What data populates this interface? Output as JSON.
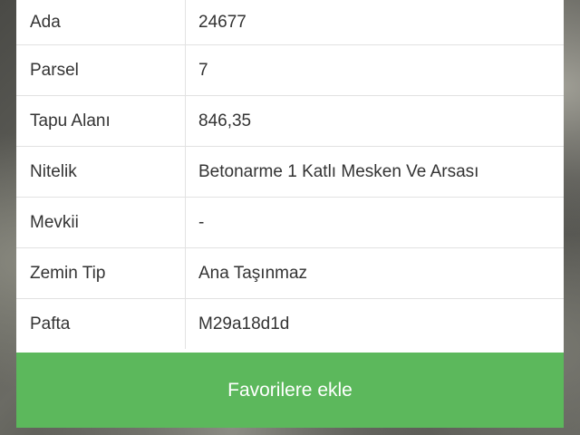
{
  "listing_details": {
    "rows": [
      {
        "label": "Ada",
        "value": "24677"
      },
      {
        "label": "Parsel",
        "value": "7"
      },
      {
        "label": "Tapu Alanı",
        "value": "846,35"
      },
      {
        "label": "Nitelik",
        "value": "Betonarme 1 Katlı Mesken Ve Arsası"
      },
      {
        "label": "Mevkii",
        "value": "-"
      },
      {
        "label": "Zemin Tip",
        "value": "Ana Taşınmaz"
      },
      {
        "label": "Pafta",
        "value": "M29a18d1d"
      }
    ]
  },
  "actions": {
    "favorite_label": "Favorilere ekle",
    "favorite_color": "#5cb85c"
  }
}
